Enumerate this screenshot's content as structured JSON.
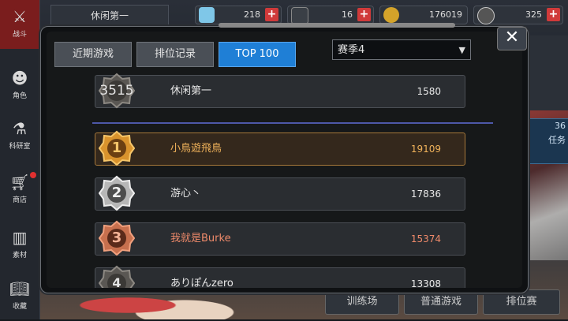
{
  "sidebar": {
    "items": [
      {
        "label": "战斗",
        "icon": "crossed-swords-icon"
      },
      {
        "label": "角色",
        "icon": "character-icon"
      },
      {
        "label": "科研室",
        "icon": "flask-icon"
      },
      {
        "label": "商店",
        "icon": "cart-icon"
      },
      {
        "label": "素材",
        "icon": "books-icon"
      },
      {
        "label": "收藏",
        "icon": "open-book-icon"
      }
    ]
  },
  "topbar": {
    "player_name": "休闲第一",
    "resources": [
      {
        "name": "diamond",
        "value": "218",
        "icon": "crystal-icon",
        "color": "#7fc7e8"
      },
      {
        "name": "ticket",
        "value": "16",
        "icon": "ticket-icon",
        "color": "#9aa0a8"
      },
      {
        "name": "gold",
        "value": "176019",
        "icon": "coin-icon",
        "color": "#d4a32a"
      },
      {
        "name": "bp",
        "value": "325",
        "icon": "bp-icon",
        "color": "#c9c9c9"
      }
    ]
  },
  "modal": {
    "tabs": [
      {
        "label": "近期游戏",
        "active": false
      },
      {
        "label": "排位记录",
        "active": false
      },
      {
        "label": "TOP 100",
        "active": true
      }
    ],
    "season_select": "赛季4",
    "close_label": "✕",
    "self_row": {
      "rank": "3515",
      "name": "休闲第一",
      "score": "1580"
    },
    "rows": [
      {
        "rank": "1",
        "name": "小鳥遊飛鳥",
        "score": "19109",
        "tier": "gold"
      },
      {
        "rank": "2",
        "name": "游心丶",
        "score": "17836",
        "tier": "silver"
      },
      {
        "rank": "3",
        "name": "我就是Burke",
        "score": "15374",
        "tier": "bronze"
      },
      {
        "rank": "4",
        "name": "ありぽんzero",
        "score": "13308",
        "tier": "plain"
      }
    ]
  },
  "background": {
    "right_box_lines": [
      "36",
      "任务"
    ],
    "bottom_buttons": [
      "训练场",
      "普通游戏",
      "排位赛"
    ]
  },
  "colors": {
    "accent_blue": "#1f7fd6",
    "gold": "#f0b25a",
    "bronze": "#ef8a6a",
    "active_nav": "#7a1d1d"
  }
}
